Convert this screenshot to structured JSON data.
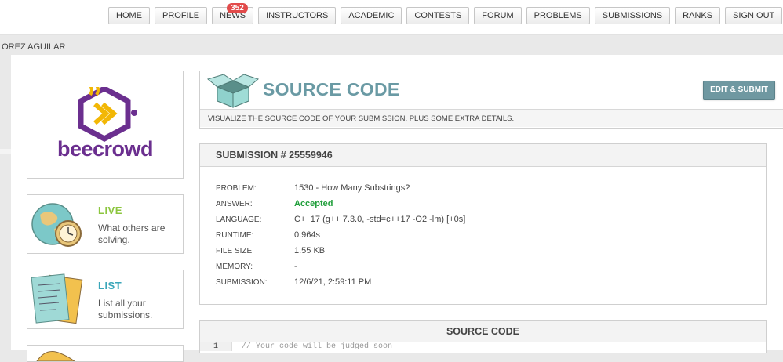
{
  "nav": {
    "items": [
      {
        "label": "HOME"
      },
      {
        "label": "PROFILE"
      },
      {
        "label": "NEWS",
        "badge": "352"
      },
      {
        "label": "INSTRUCTORS"
      },
      {
        "label": "ACADEMIC"
      },
      {
        "label": "CONTESTS"
      },
      {
        "label": "FORUM"
      },
      {
        "label": "PROBLEMS"
      },
      {
        "label": "SUBMISSIONS"
      },
      {
        "label": "RANKS"
      },
      {
        "label": "SIGN OUT"
      }
    ]
  },
  "user": {
    "name": "LOREZ AGUILAR"
  },
  "logo": {
    "text": "beecrowd",
    "color": "#6b2f8f"
  },
  "sidebar": {
    "live": {
      "title": "LIVE",
      "desc": "What others are solving.",
      "icon": "globe-clock-icon"
    },
    "list": {
      "title": "LIST",
      "desc": "List all your submissions.",
      "icon": "papers-icon"
    }
  },
  "header": {
    "title": "SOURCE CODE",
    "subtitle": "VISUALIZE THE SOURCE CODE OF YOUR SUBMISSION, PLUS SOME EXTRA DETAILS.",
    "edit_button": "EDIT & SUBMIT",
    "icon": "open-box-icon"
  },
  "submission": {
    "heading": "SUBMISSION # 25559946",
    "fields": [
      {
        "key": "PROBLEM:",
        "value": "1530 - How Many Substrings?"
      },
      {
        "key": "ANSWER:",
        "value": "Accepted"
      },
      {
        "key": "LANGUAGE:",
        "value": "C++17 (g++ 7.3.0, -std=c++17 -O2 -lm) [+0s]"
      },
      {
        "key": "RUNTIME:",
        "value": "0.964s"
      },
      {
        "key": "FILE SIZE:",
        "value": "1.55 KB"
      },
      {
        "key": "MEMORY:",
        "value": "-"
      },
      {
        "key": "SUBMISSION:",
        "value": "12/6/21, 2:59:11 PM"
      }
    ],
    "answer_color": "#1f9e3a"
  },
  "code": {
    "heading": "SOURCE CODE",
    "line_number": "1",
    "first_line": "// Your code will be judged soon"
  }
}
